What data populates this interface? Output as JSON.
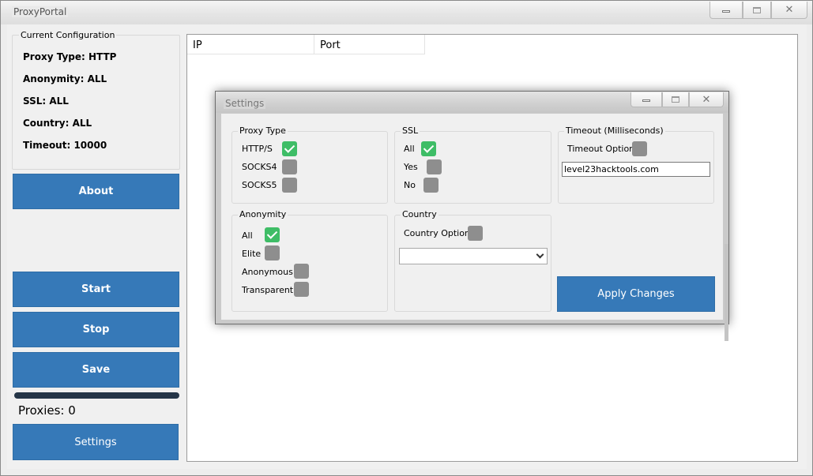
{
  "window": {
    "title": "ProxyPortal"
  },
  "config": {
    "legend": "Current Configuration",
    "lines": [
      "Proxy Type: HTTP",
      "Anonymity: ALL",
      "SSL: ALL",
      "Country: ALL",
      "Timeout: 10000"
    ]
  },
  "buttons": {
    "about": "About",
    "start": "Start",
    "stop": "Stop",
    "save": "Save",
    "settings": "Settings"
  },
  "status": {
    "proxies": "Proxies: 0",
    "progress_fraction": 0
  },
  "list": {
    "columns": [
      "IP",
      "Port"
    ]
  },
  "settings_dialog": {
    "title": "Settings",
    "proxy_type": {
      "legend": "Proxy Type",
      "options": [
        {
          "label": "HTTP/S",
          "checked": true
        },
        {
          "label": "SOCKS4",
          "checked": false
        },
        {
          "label": "SOCKS5",
          "checked": false
        }
      ]
    },
    "ssl": {
      "legend": "SSL",
      "options": [
        {
          "label": "All",
          "checked": true
        },
        {
          "label": "Yes",
          "checked": false
        },
        {
          "label": "No",
          "checked": false
        }
      ]
    },
    "timeout": {
      "legend": "Timeout (Milliseconds)",
      "option_label": "Timeout Option",
      "option_checked": false,
      "value": "level23hacktools.com"
    },
    "anonymity": {
      "legend": "Anonymity",
      "options": [
        {
          "label": "All",
          "checked": true
        },
        {
          "label": "Elite",
          "checked": false
        },
        {
          "label": "Anonymous",
          "checked": false
        },
        {
          "label": "Transparent",
          "checked": false
        }
      ]
    },
    "country": {
      "legend": "Country",
      "option_label": "Country Option",
      "option_checked": false,
      "selected": ""
    },
    "apply_label": "Apply Changes"
  },
  "colors": {
    "button_blue": "#3679b8",
    "checkbox_on": "#3ebd66",
    "checkbox_off": "#8e8e8e"
  }
}
